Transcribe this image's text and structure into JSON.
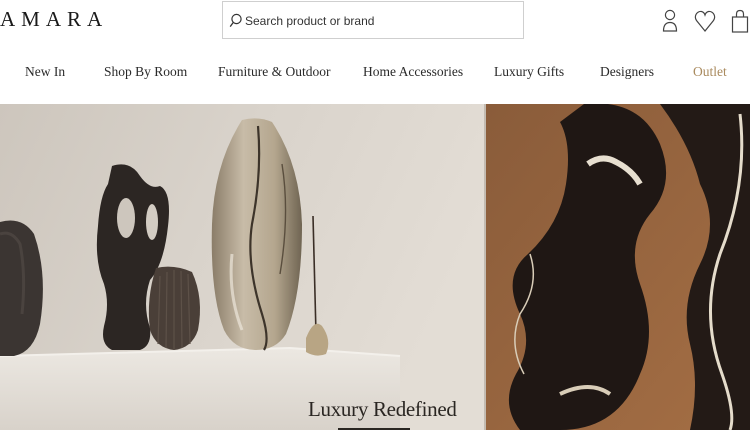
{
  "header": {
    "logo": "AMARA",
    "search": {
      "placeholder": "Search product or brand"
    }
  },
  "icons": {
    "search": "search-icon",
    "account": "user-icon",
    "wishlist": "heart-icon",
    "bag": "shopping-bag-icon"
  },
  "nav": {
    "items": [
      {
        "label": "New In"
      },
      {
        "label": "Shop By Room"
      },
      {
        "label": "Furniture & Outdoor"
      },
      {
        "label": "Home Accessories"
      },
      {
        "label": "Luxury Gifts"
      },
      {
        "label": "Designers"
      },
      {
        "label": "Outlet"
      }
    ]
  },
  "hero": {
    "title": "Luxury Redefined"
  },
  "colors": {
    "accent_outlet": "#a98a5e",
    "text": "#2a2a2a",
    "border": "#cfcfcf"
  }
}
